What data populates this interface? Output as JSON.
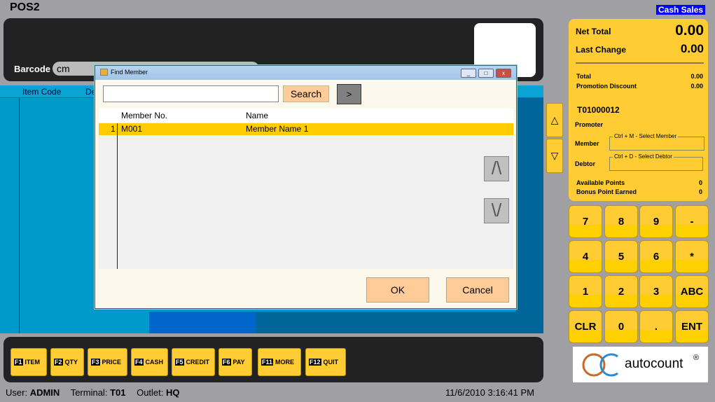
{
  "app": {
    "title": "POS2",
    "mode": "Cash Sales"
  },
  "barcode": {
    "label": "Barcode",
    "value": "cm"
  },
  "grid": {
    "columns": [
      "Item Code",
      "De"
    ]
  },
  "dialog": {
    "title": "Find Member",
    "search_value": "",
    "search_label": "Search",
    "next_label": ">",
    "columns": [
      "Member No.",
      "Name"
    ],
    "rows": [
      {
        "index": "1",
        "member_no": "M001",
        "name": "Member Name 1"
      }
    ],
    "ok_label": "OK",
    "cancel_label": "Cancel",
    "scroll_up": "/\\",
    "scroll_down": "\\/"
  },
  "side_arrows": {
    "up": "△",
    "down": "▽"
  },
  "summary": {
    "net_total_label": "Net Total",
    "net_total": "0.00",
    "last_change_label": "Last Change",
    "last_change": "0.00",
    "total_label": "Total",
    "total": "0.00",
    "promo_label": "Promotion Discount",
    "promo": "0.00",
    "doc_no": "T01000012",
    "promoter_label": "Promoter",
    "member_label": "Member",
    "member_hint": "Ctrl + M - Select Member",
    "debtor_label": "Debtor",
    "debtor_hint": "Ctrl + D - Select Debtor",
    "points_label": "Available Points",
    "points": "0",
    "bonus_label": "Bonus Point Earned",
    "bonus": "0"
  },
  "keypad": [
    "7",
    "8",
    "9",
    "-",
    "4",
    "5",
    "6",
    "*",
    "1",
    "2",
    "3",
    "ABC",
    "CLR",
    "0",
    ".",
    "ENT"
  ],
  "logo": {
    "text": "autocount",
    "mark": "®"
  },
  "fkeys": [
    {
      "key": "F1",
      "label": "ITEM"
    },
    {
      "key": "F2",
      "label": "QTY"
    },
    {
      "key": "F3",
      "label": "PRICE"
    },
    {
      "key": "F4",
      "label": "CASH"
    },
    {
      "key": "F5",
      "label": "CREDIT"
    },
    {
      "key": "F6",
      "label": "PAY"
    },
    {
      "key": "F11",
      "label": "MORE"
    },
    {
      "key": "F12",
      "label": "QUIT"
    }
  ],
  "status": {
    "user_label": "User:",
    "user": "ADMIN",
    "terminal_label": "Terminal:",
    "terminal": "T01",
    "outlet_label": "Outlet:",
    "outlet": "HQ",
    "datetime": "11/6/2010 3:16:41 PM"
  }
}
